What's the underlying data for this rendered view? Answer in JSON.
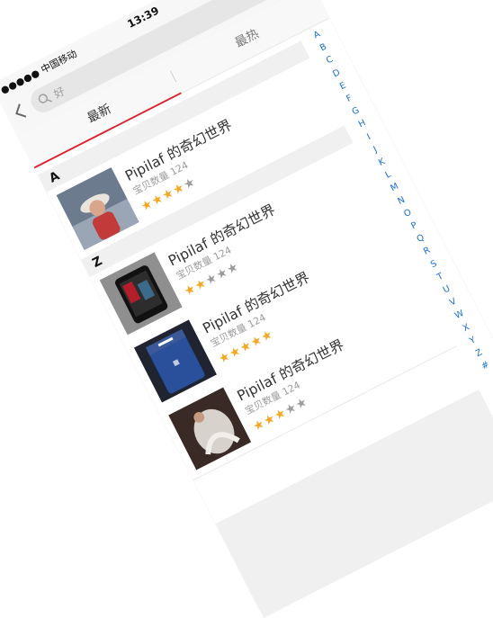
{
  "status": {
    "carrier": "●●●●● 中国移动",
    "time": "13:39"
  },
  "search": {
    "placeholder": "好"
  },
  "tabs": [
    {
      "label": "最新",
      "active": true
    },
    {
      "label": "最热",
      "active": false
    }
  ],
  "colors": {
    "accent": "#d9232d",
    "index": "#1b6fd1",
    "star_on": "#f5a623",
    "star_off": "#9b9b9b"
  },
  "sections": [
    {
      "letter": "A",
      "items": [
        {
          "title": "Pipilaf 的奇幻世界",
          "count": "宝贝数量 124",
          "rating": 4,
          "thumb": "photo-person-hat"
        }
      ]
    },
    {
      "letter": "Z",
      "items": [
        {
          "title": "Pipilaf 的奇幻世界",
          "count": "宝贝数量 124",
          "rating": 2,
          "thumb": "photo-smartphone"
        },
        {
          "title": "Pipilaf 的奇幻世界",
          "count": "宝贝数量 124",
          "rating": 5,
          "thumb": "photo-facebook-phone"
        },
        {
          "title": "Pipilaf 的奇幻世界",
          "count": "宝贝数量 124",
          "rating": 3,
          "thumb": "photo-dancer"
        }
      ]
    }
  ],
  "index_letters": [
    "A",
    "B",
    "C",
    "D",
    "E",
    "F",
    "G",
    "H",
    "I",
    "J",
    "K",
    "L",
    "M",
    "N",
    "O",
    "P",
    "Q",
    "R",
    "S",
    "T",
    "U",
    "V",
    "W",
    "X",
    "Y",
    "Z",
    "#"
  ]
}
